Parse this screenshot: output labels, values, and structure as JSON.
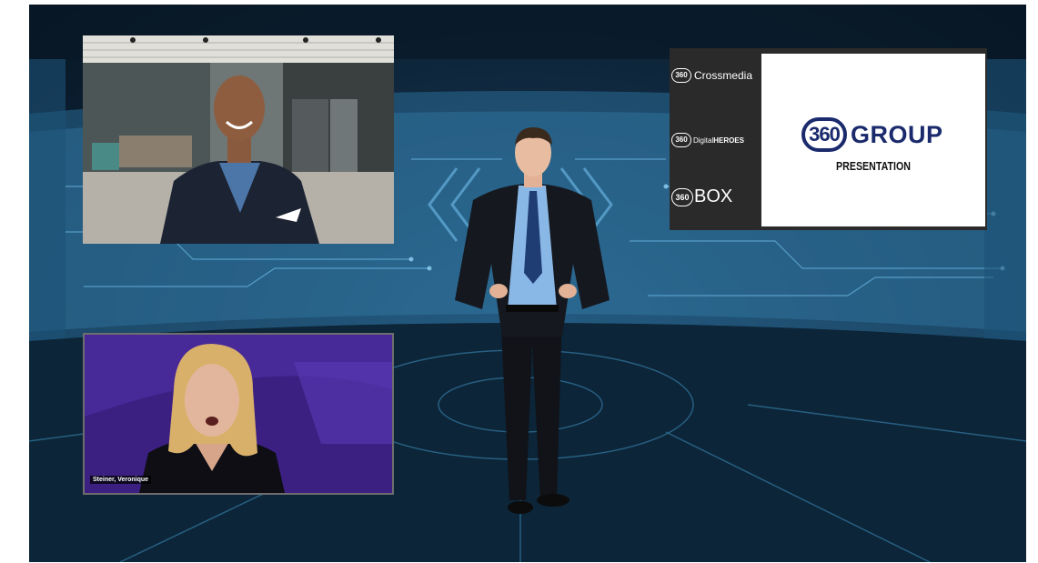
{
  "host_tile": {},
  "guest_tile": {
    "caption": "Steiner, Veronique"
  },
  "presentation": {
    "logos": [
      {
        "badge": "360",
        "label": "Crossmedia"
      },
      {
        "badge": "360",
        "label_prefix": "Digital",
        "label_bold": "HEROES"
      },
      {
        "badge": "360",
        "label": "BOX"
      }
    ],
    "group_badge": "360",
    "group_word": "GROUP",
    "subtitle": "PRESENTATION"
  },
  "colors": {
    "brand_navy": "#1a2a6c",
    "stage_blue": "#1e4a6b",
    "guest_bg": "#3a1d7a"
  }
}
